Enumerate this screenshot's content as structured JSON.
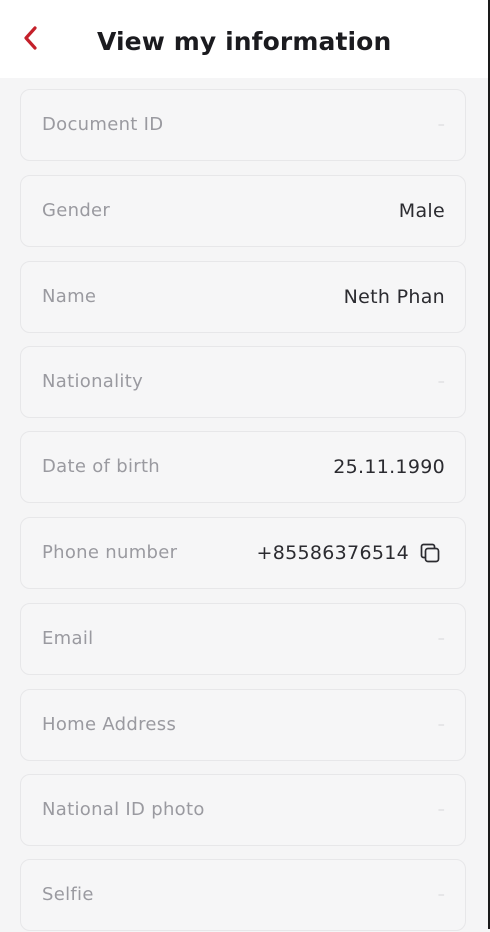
{
  "header": {
    "title": "View my information",
    "back_icon": "chevron-left-icon",
    "accent_color": "#c4202a"
  },
  "fields": [
    {
      "key": "document-id",
      "label": "Document ID",
      "value": "–"
    },
    {
      "key": "gender",
      "label": "Gender",
      "value": "Male"
    },
    {
      "key": "name",
      "label": "Name",
      "value": "Neth Phan"
    },
    {
      "key": "nationality",
      "label": "Nationality",
      "value": "–"
    },
    {
      "key": "date-of-birth",
      "label": "Date of birth",
      "value": "25.11.1990"
    },
    {
      "key": "phone-number",
      "label": "Phone number",
      "value": "+85586376514",
      "icon": "copy-icon"
    },
    {
      "key": "email",
      "label": "Email",
      "value": "–"
    },
    {
      "key": "home-address",
      "label": "Home Address",
      "value": "–"
    },
    {
      "key": "national-id-photo",
      "label": "National ID photo",
      "value": "–"
    },
    {
      "key": "selfie",
      "label": "Selfie",
      "value": "–"
    }
  ]
}
